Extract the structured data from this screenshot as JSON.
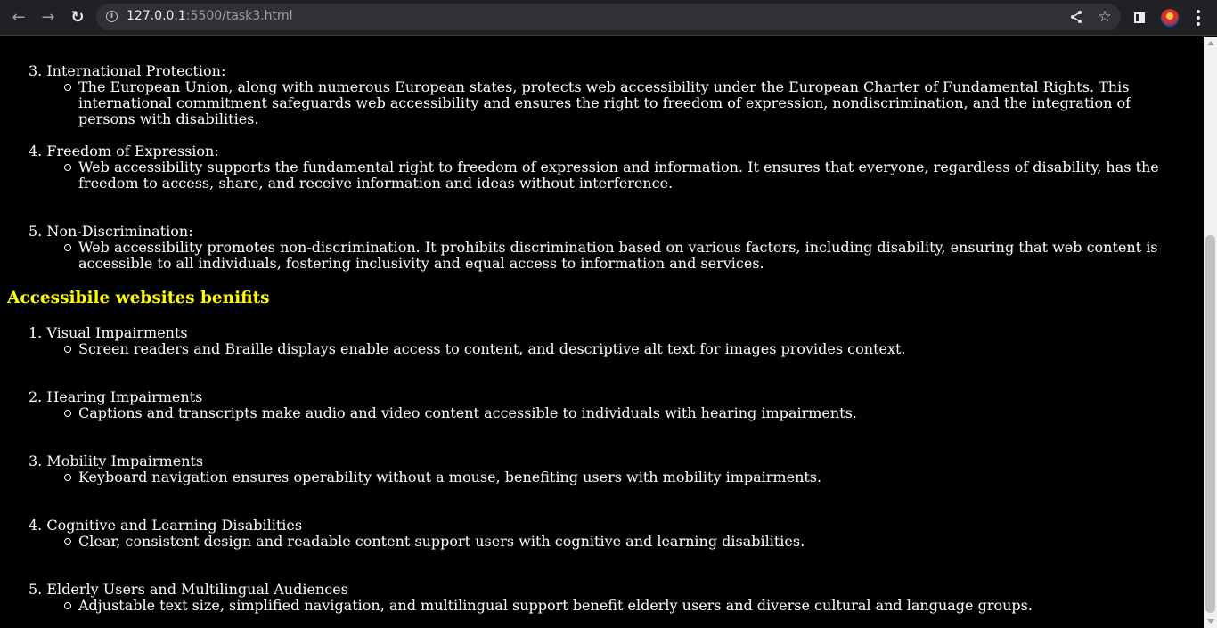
{
  "browser": {
    "back_icon": "←",
    "forward_icon": "→",
    "reload_icon": "↻",
    "url_host": "127.0.0.1",
    "url_path": ":5500/task3.html",
    "share_icon": "share-icon",
    "star_icon": "☆"
  },
  "page": {
    "rights_items": [
      {
        "label": "3. International Protection:",
        "detail": "The European Union, along with numerous European states, protects web accessibility under the European Charter of Fundamental Rights. This international commitment safeguards web accessibility and ensures the right to freedom of expression, nondiscrimination, and the integration of persons with disabilities."
      },
      {
        "label": "4. Freedom of Expression:",
        "detail": "Web accessibility supports the fundamental right to freedom of expression and information. It ensures that everyone, regardless of disability, has the freedom to access, share, and receive information and ideas without interference."
      },
      {
        "label": "5. Non-Discrimination:",
        "detail": "Web accessibility promotes non-discrimination. It prohibits discrimination based on various factors, including disability, ensuring that web content is accessible to all individuals, fostering inclusivity and equal access to information and services."
      }
    ],
    "benefits_heading": "Accessibile websites benifits",
    "benefit_items": [
      {
        "label": "1. Visual Impairments",
        "detail": "Screen readers and Braille displays enable access to content, and descriptive alt text for images provides context."
      },
      {
        "label": "2. Hearing Impairments",
        "detail": "Captions and transcripts make audio and video content accessible to individuals with hearing impairments."
      },
      {
        "label": "3. Mobility Impairments",
        "detail": "Keyboard navigation ensures operability without a mouse, benefiting users with mobility impairments."
      },
      {
        "label": "4. Cognitive and Learning Disabilities",
        "detail": "Clear, consistent design and readable content support users with cognitive and learning disabilities."
      },
      {
        "label": "5. Elderly Users and Multilingual Audiences",
        "detail": "Adjustable text size, simplified navigation, and multilingual support benefit elderly users and diverse cultural and language groups."
      }
    ]
  }
}
